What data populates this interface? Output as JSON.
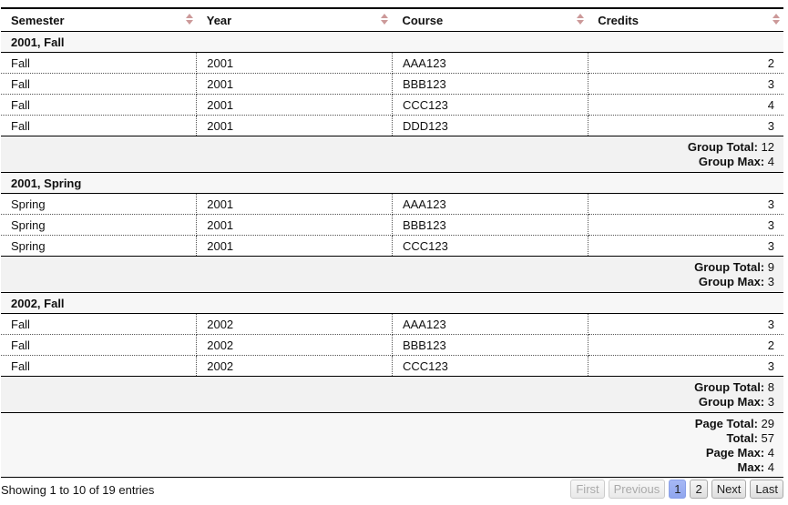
{
  "columns": [
    "Semester",
    "Year",
    "Course",
    "Credits"
  ],
  "groups": [
    {
      "label": "2001, Fall",
      "rows": [
        [
          "Fall",
          "2001",
          "AAA123",
          "2"
        ],
        [
          "Fall",
          "2001",
          "BBB123",
          "3"
        ],
        [
          "Fall",
          "2001",
          "CCC123",
          "4"
        ],
        [
          "Fall",
          "2001",
          "DDD123",
          "3"
        ]
      ],
      "total_label": "Group Total:",
      "total": "12",
      "max_label": "Group Max:",
      "max": "4"
    },
    {
      "label": "2001, Spring",
      "rows": [
        [
          "Spring",
          "2001",
          "AAA123",
          "3"
        ],
        [
          "Spring",
          "2001",
          "BBB123",
          "3"
        ],
        [
          "Spring",
          "2001",
          "CCC123",
          "3"
        ]
      ],
      "total_label": "Group Total:",
      "total": "9",
      "max_label": "Group Max:",
      "max": "3"
    },
    {
      "label": "2002, Fall",
      "rows": [
        [
          "Fall",
          "2002",
          "AAA123",
          "3"
        ],
        [
          "Fall",
          "2002",
          "BBB123",
          "2"
        ],
        [
          "Fall",
          "2002",
          "CCC123",
          "3"
        ]
      ],
      "total_label": "Group Total:",
      "total": "8",
      "max_label": "Group Max:",
      "max": "3"
    }
  ],
  "page_summary": {
    "page_total_label": "Page Total:",
    "page_total": "29",
    "total_label": "Total:",
    "total": "57",
    "page_max_label": "Page Max:",
    "page_max": "4",
    "max_label": "Max:",
    "max": "4"
  },
  "info": "Showing 1 to 10 of 19 entries",
  "pagination": {
    "first": "First",
    "previous": "Previous",
    "pages": [
      "1",
      "2"
    ],
    "active_page": "1",
    "next": "Next",
    "last": "Last"
  },
  "colors": {
    "sort_arrow": "#cc9999",
    "active_page": "#8fa6ee",
    "group_bg": "#f7f7f7"
  }
}
